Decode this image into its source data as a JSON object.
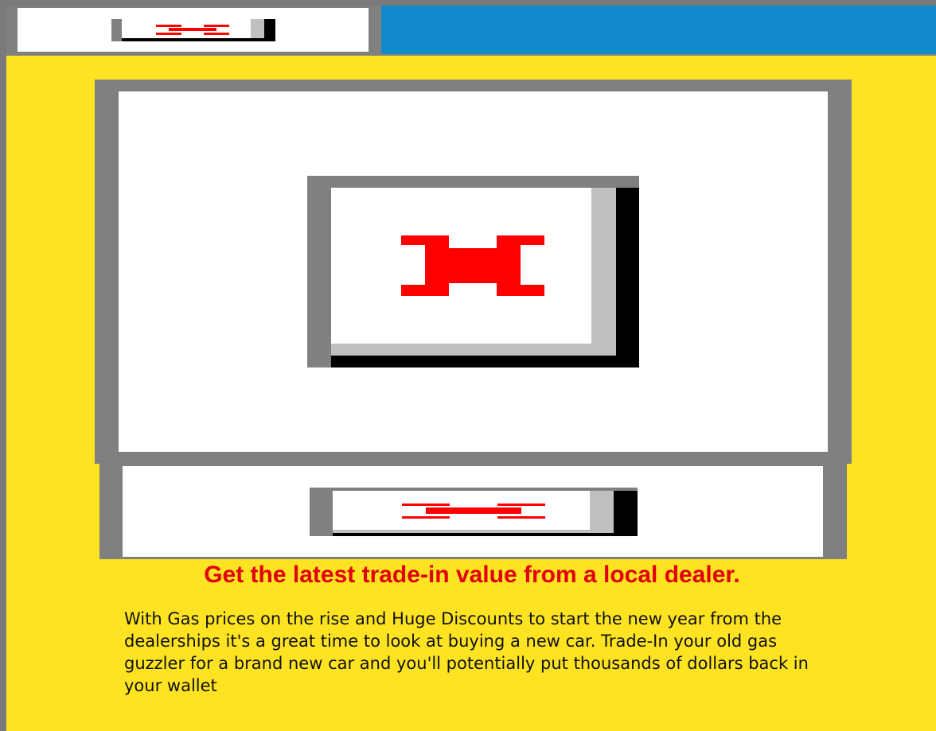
{
  "page": {
    "colors": {
      "background": "#fde322",
      "header_bar": "#118acd",
      "frame": "#808080",
      "headline": "#e0000f",
      "broken_icon": "#ff0000"
    }
  },
  "header": {
    "logo_image": {
      "state": "broken-image-placeholder",
      "icon": "broken-image-icon"
    }
  },
  "ad": {
    "main_image": {
      "state": "broken-image-placeholder",
      "icon": "broken-image-icon"
    },
    "secondary_image": {
      "state": "broken-image-placeholder",
      "icon": "broken-image-icon"
    }
  },
  "main": {
    "headline": "Get the latest trade-in value from a local dealer.",
    "paragraph": "With Gas prices on the rise and Huge Discounts to start the new year from the dealerships it's a great time to look at buying a new car. Trade-In your old gas guzzler for a brand new car and you'll potentially put thousands of dollars back in your wallet"
  }
}
